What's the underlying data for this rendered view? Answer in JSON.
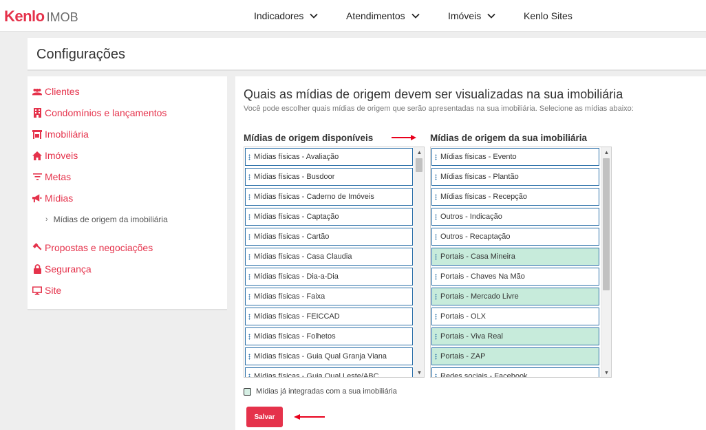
{
  "brand": {
    "name": "Kenlo",
    "product": "IMOB",
    "accent": "#e5324b"
  },
  "nav": {
    "items": [
      {
        "label": "Indicadores",
        "dropdown": true
      },
      {
        "label": "Atendimentos",
        "dropdown": true
      },
      {
        "label": "Imóveis",
        "dropdown": true
      },
      {
        "label": "Kenlo Sites",
        "dropdown": false
      }
    ]
  },
  "page": {
    "title": "Configurações"
  },
  "sidebar": {
    "items": [
      {
        "label": "Clientes",
        "icon": "users-icon"
      },
      {
        "label": "Condomínios e lançamentos",
        "icon": "building-icon"
      },
      {
        "label": "Imobiliária",
        "icon": "store-icon"
      },
      {
        "label": "Imóveis",
        "icon": "home-icon"
      },
      {
        "label": "Metas",
        "icon": "filter-icon"
      },
      {
        "label": "Mídias",
        "icon": "megaphone-icon"
      },
      {
        "label": "Propostas e negociações",
        "icon": "gavel-icon"
      },
      {
        "label": "Segurança",
        "icon": "lock-icon"
      },
      {
        "label": "Site",
        "icon": "monitor-icon"
      }
    ],
    "sub_item": {
      "label": "Mídias de origem da imobiliária"
    }
  },
  "main": {
    "title": "Quais as mídias de origem devem ser visualizadas na sua imobiliária",
    "subtitle": "Você pode escolher quais mídias de origem que serão apresentadas na sua imobiliária. Selecione as mídias abaixo:",
    "available": {
      "title": "Mídias de origem disponíveis",
      "items": [
        {
          "label": "Mídias físicas - Avaliação",
          "selected": false
        },
        {
          "label": "Mídias físicas - Busdoor",
          "selected": false
        },
        {
          "label": "Mídias físicas - Caderno de Imóveis",
          "selected": false
        },
        {
          "label": "Mídias físicas - Captação",
          "selected": false
        },
        {
          "label": "Mídias físicas - Cartão",
          "selected": false
        },
        {
          "label": "Mídias físicas - Casa Claudia",
          "selected": false
        },
        {
          "label": "Mídias físicas - Dia-a-Dia",
          "selected": false
        },
        {
          "label": "Mídias físicas - Faixa",
          "selected": false
        },
        {
          "label": "Mídias físicas - FEICCAD",
          "selected": false
        },
        {
          "label": "Mídias físicas - Folhetos",
          "selected": false
        },
        {
          "label": "Mídias físicas - Guia Qual Granja Viana",
          "selected": false
        },
        {
          "label": "Mídias físicas - Guia Qual Leste/ABC",
          "selected": false
        }
      ]
    },
    "mine": {
      "title": "Mídias de origem da sua imobiliária",
      "items": [
        {
          "label": "Mídias físicas - Evento",
          "selected": false
        },
        {
          "label": "Mídias físicas - Plantão",
          "selected": false
        },
        {
          "label": "Mídias físicas - Recepção",
          "selected": false
        },
        {
          "label": "Outros - Indicação",
          "selected": false
        },
        {
          "label": "Outros - Recaptação",
          "selected": false
        },
        {
          "label": "Portais - Casa Mineira",
          "selected": true
        },
        {
          "label": "Portais - Chaves Na Mão",
          "selected": false
        },
        {
          "label": "Portais - Mercado Livre",
          "selected": true
        },
        {
          "label": "Portais - OLX",
          "selected": false
        },
        {
          "label": "Portais - Viva Real",
          "selected": true
        },
        {
          "label": "Portais - ZAP",
          "selected": true
        },
        {
          "label": "Redes sociais - Facebook",
          "selected": false
        }
      ]
    },
    "integrated_checkbox": {
      "label": "Mídias já integradas com a sua imobiliária"
    },
    "save_label": "Salvar"
  },
  "colors": {
    "selected_row": "#c7ebdb",
    "row_border": "#2a6fa8",
    "annotation_arrow": "#e8001c"
  }
}
